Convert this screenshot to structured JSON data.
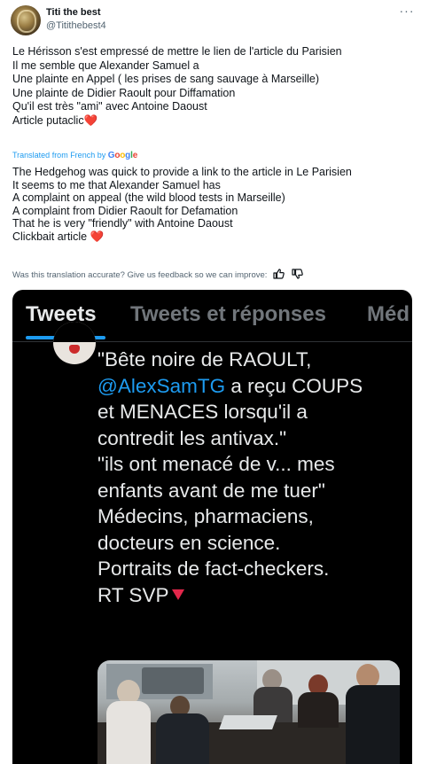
{
  "author": {
    "display_name": "Titi the best",
    "handle": "@Titithebest4"
  },
  "more_icon": "more-horizontal-icon",
  "tweet_lines": [
    "Le Hérisson s'est empressé de mettre le lien de l'article du Parisien",
    "Il me semble que Alexander Samuel a",
    "Une plainte en Appel  ( les prises de sang sauvage à Marseille)",
    "Une plainte de Didier Raoult pour Diffamation",
    "Qu'il est très \"ami\" avec Antoine Daoust",
    "Article putaclic"
  ],
  "translation": {
    "label": "Translated from French by",
    "provider_letters": [
      "G",
      "o",
      "o",
      "g",
      "l",
      "e"
    ],
    "lines": [
      "The Hedgehog was quick to provide a link to the article in Le Parisien",
      "It seems to me that Alexander Samuel has",
      "A complaint on appeal (the wild blood tests in Marseille)",
      "A complaint from Didier Raoult for Defamation",
      "That he is very \"friendly\" with Antoine Daoust",
      "Clickbait article"
    ],
    "feedback_prompt": "Was this translation accurate? Give us feedback so we can improve:"
  },
  "embedded_screenshot": {
    "tabs": [
      "Tweets",
      "Tweets et réponses",
      "Méd"
    ],
    "active_tab": "Tweets",
    "quote_lines": [
      "\"Bête noire de RAOULT,",
      "a reçu COUPS",
      "et MENACES lorsqu'il a",
      "contredit les antivax.\"",
      "\"ils ont menacé de v... mes",
      "enfants avant de me tuer\"",
      "Médecins, pharmaciens,",
      "docteurs en science.",
      "Portraits de fact-checkers.",
      "RT SVP"
    ],
    "mention": "@AlexSamTG",
    "accent_color": "#1d9bf0"
  },
  "colors": {
    "heart": "#e0245e",
    "link": "#1d9bf0",
    "secondary_text": "#536471",
    "red_triangle": "#e2274b"
  }
}
